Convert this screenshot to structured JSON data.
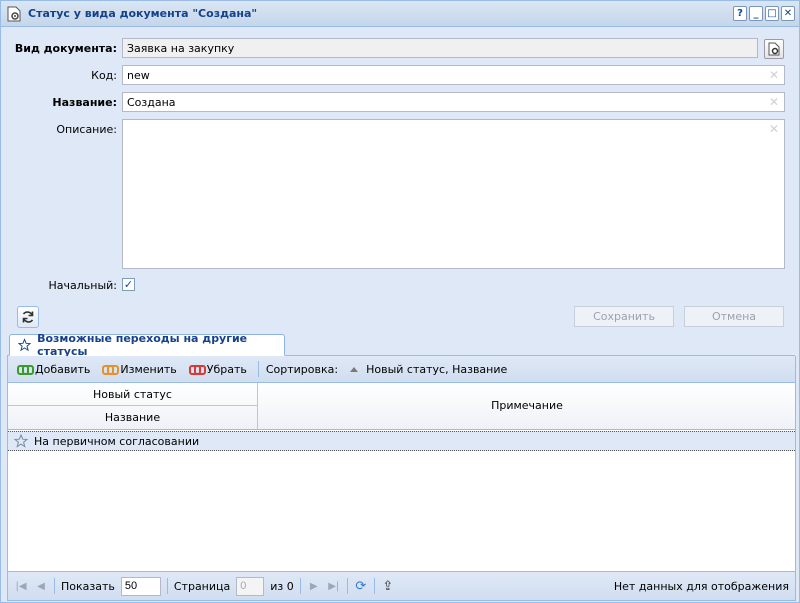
{
  "window": {
    "title": "Статус у вида документа \"Создана\"",
    "icon": "document-gear-icon",
    "tools": [
      "?",
      "_",
      "□",
      "✕"
    ]
  },
  "form": {
    "doc_type_label": "Вид документа:",
    "doc_type_value": "Заявка на закупку",
    "code_label": "Код:",
    "code_value": "new",
    "name_label": "Название:",
    "name_value": "Создана",
    "description_label": "Описание:",
    "description_value": "",
    "initial_label": "Начальный:",
    "initial_checked": true
  },
  "actions": {
    "save_label": "Сохранить",
    "cancel_label": "Отмена"
  },
  "tabs": [
    {
      "label": "Возможные переходы на другие статусы",
      "icon": "star-icon",
      "active": true
    }
  ],
  "toolbar": {
    "add_label": "Добавить",
    "edit_label": "Изменить",
    "remove_label": "Убрать",
    "sort_label": "Сортировка:",
    "sort_value": "Новый статус, Название"
  },
  "grid": {
    "group_header": "Новый статус",
    "col_name": "Название",
    "col_note": "Примечание",
    "rows": [
      {
        "name": "На первичном согласовании",
        "note": ""
      }
    ]
  },
  "pager": {
    "show_label": "Показать",
    "page_size": "50",
    "page_label": "Страница",
    "page_value": "0",
    "of_label": "из 0",
    "status": "Нет данных для отображения"
  },
  "colors": {
    "title_text": "#15428b",
    "panel_bg": "#dfe8f6",
    "border": "#99bbe8"
  }
}
